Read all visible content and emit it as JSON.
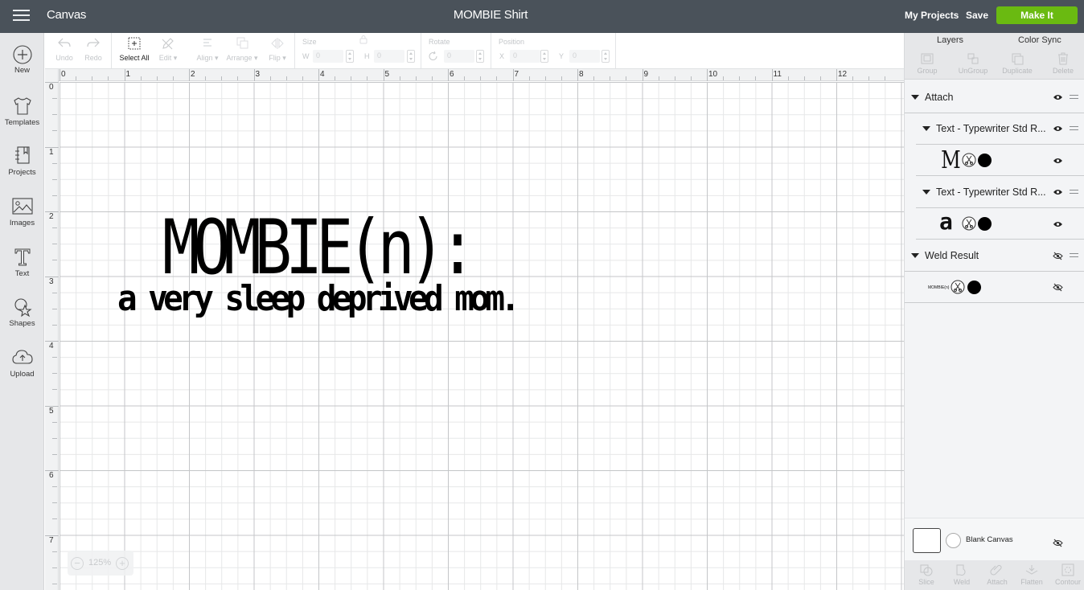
{
  "topbar": {
    "app_title": "Canvas",
    "document_title": "MOMBIE Shirt",
    "my_projects_label": "My Projects",
    "save_label": "Save",
    "make_it_label": "Make It",
    "make_it_color": "#6aba11"
  },
  "sidebar": {
    "items": [
      {
        "label": "New",
        "icon": "plus-circle-icon"
      },
      {
        "label": "Templates",
        "icon": "tshirt-icon"
      },
      {
        "label": "Projects",
        "icon": "notebook-icon"
      },
      {
        "label": "Images",
        "icon": "image-icon"
      },
      {
        "label": "Text",
        "icon": "text-t-icon"
      },
      {
        "label": "Shapes",
        "icon": "shapes-icon"
      },
      {
        "label": "Upload",
        "icon": "cloud-upload-icon"
      }
    ]
  },
  "toolbar": {
    "undo": "Undo",
    "redo": "Redo",
    "select_all": "Select All",
    "edit": "Edit",
    "align": "Align",
    "arrange": "Arrange",
    "flip": "Flip",
    "size_label": "Size",
    "w_label": "W",
    "w_value": "0",
    "h_label": "H",
    "h_value": "0",
    "rotate_label": "Rotate",
    "rotate_value": "0",
    "position_label": "Position",
    "x_label": "X",
    "x_value": "0",
    "y_label": "Y",
    "y_value": "0"
  },
  "rulers": {
    "top": [
      "0",
      "1",
      "2",
      "3",
      "4",
      "5",
      "6",
      "7",
      "8",
      "9",
      "10",
      "11",
      "12"
    ],
    "left": [
      "0",
      "1",
      "2",
      "3",
      "4",
      "5",
      "6",
      "7"
    ]
  },
  "canvas": {
    "design_title": "MOMBIE(n):",
    "design_subtitle": "a very sleep deprived mom.",
    "zoom_value": "125%"
  },
  "right_panel": {
    "tabs": {
      "layers": "Layers",
      "color_sync": "Color Sync"
    },
    "tools": {
      "group": "Group",
      "ungroup": "UnGroup",
      "duplicate": "Duplicate",
      "delete": "Delete"
    },
    "layers": [
      {
        "name": "Attach",
        "type": "group",
        "visible": true
      },
      {
        "name": "Text - Typewriter Std R...",
        "type": "subgroup",
        "visible": true
      },
      {
        "thumbnail": "M",
        "type": "item",
        "visible": true
      },
      {
        "name": "Text - Typewriter Std R...",
        "type": "subgroup",
        "visible": true
      },
      {
        "thumbnail": "a",
        "type": "item",
        "visible": true
      },
      {
        "name": "Weld Result",
        "type": "group",
        "visible": false
      },
      {
        "thumbnail": "MOMBIE(n)",
        "type": "item",
        "visible": false
      }
    ],
    "blank_canvas_label": "Blank Canvas",
    "bottom_tools": {
      "slice": "Slice",
      "weld": "Weld",
      "attach": "Attach",
      "flatten": "Flatten",
      "contour": "Contour"
    }
  }
}
